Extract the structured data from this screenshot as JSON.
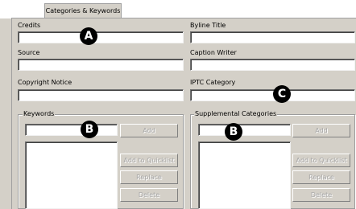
{
  "tab": {
    "label": "Categories & Keywords"
  },
  "fields": {
    "credits": {
      "label": "Credits",
      "value": ""
    },
    "byline_title": {
      "label": "Byline Title",
      "value": ""
    },
    "source": {
      "label": "Source",
      "value": ""
    },
    "caption_writer": {
      "label": "Caption Writer",
      "value": ""
    },
    "copyright_notice": {
      "label": "Copyright Notice",
      "value": ""
    },
    "iptc_category": {
      "label": "IPTC Category",
      "value": ""
    }
  },
  "keywords": {
    "title": "Keywords",
    "input_value": "",
    "buttons": {
      "add": "Add",
      "add_to_quicklist": "Add to Quicklist",
      "replace": "Replace",
      "delete": "Delete"
    }
  },
  "supplemental": {
    "title": "Supplemental Categories",
    "input_value": "",
    "buttons": {
      "add": "Add",
      "add_to_quicklist": "Add to Quicklist",
      "replace": "Replace",
      "delete": "Delete"
    }
  },
  "markers": {
    "a": "A",
    "b": "B",
    "c": "C"
  }
}
